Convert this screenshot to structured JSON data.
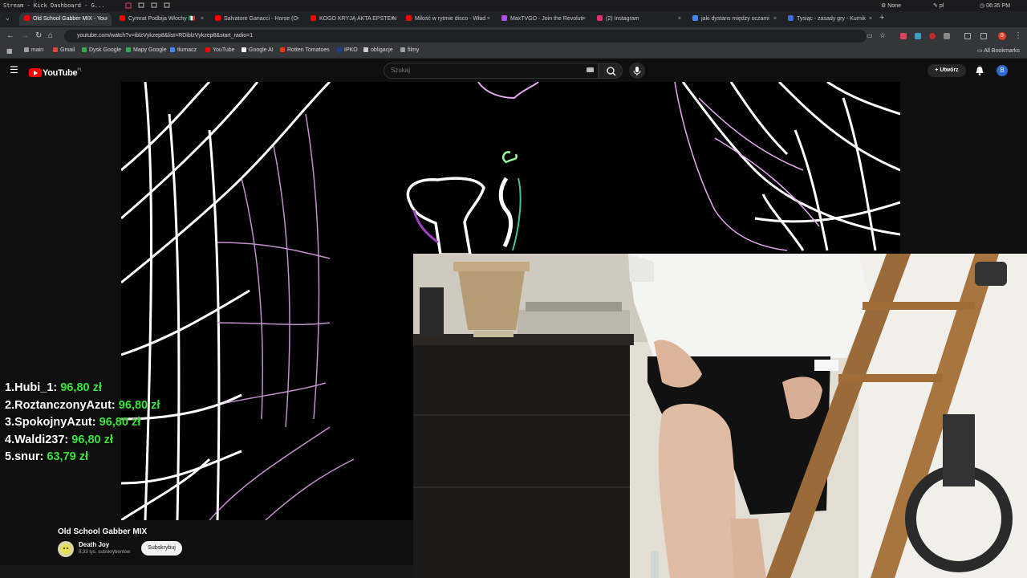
{
  "os_bar": {
    "window_title": "Stream - Kick Dashboard - G...",
    "lang_status": "None",
    "keyboard": "pl",
    "clock": "06:35 PM"
  },
  "tabs": [
    {
      "title": "Old School Gabber MIX - You",
      "color": "#ff0000",
      "active": true
    },
    {
      "title": "Cymrat Podbija Włochy 🇮🇹",
      "color": "#ff0000"
    },
    {
      "title": "Salvatore Ganacci - Horse (O",
      "color": "#ff0000"
    },
    {
      "title": "KOGO KRYJĄ AKTA EPSTEIN",
      "color": "#ff0000"
    },
    {
      "title": "Miłość w rytmie disco - Wład",
      "color": "#ff0000"
    },
    {
      "title": "MaxTVGO - Join the Revoluti",
      "color": "#b24bf3"
    },
    {
      "title": "(2) Instagram",
      "color": "#e1306c"
    },
    {
      "title": "jaki dystans między oczami",
      "color": "#4285f4"
    },
    {
      "title": "Tysiąc - zasady gry - Kurnik",
      "color": "#3b6fd6"
    }
  ],
  "address": {
    "url": "youtube.com/watch?v=iblzVykzep8&list=RDiblzVykzep8&start_radio=1"
  },
  "bookmarks": [
    {
      "label": "main",
      "color": "#9aa0a6"
    },
    {
      "label": "Gmail",
      "color": "#ea4335"
    },
    {
      "label": "Dysk Google",
      "color": "#34a853"
    },
    {
      "label": "Mapy Google",
      "color": "#34a853"
    },
    {
      "label": "tłumacz",
      "color": "#4285f4"
    },
    {
      "label": "YouTube",
      "color": "#ff0000"
    },
    {
      "label": "Google AI",
      "color": "#ffffff"
    },
    {
      "label": "Rotten Tomatoes",
      "color": "#fa320a"
    },
    {
      "label": "IPKO",
      "color": "#1c3f94"
    },
    {
      "label": "obligacje",
      "color": "#cccccc"
    },
    {
      "label": "filmy",
      "color": "#9aa0a6"
    }
  ],
  "all_bookmarks": "All Bookmarks",
  "youtube": {
    "logo_text": "YouTube",
    "logo_region": "PL",
    "search_placeholder": "Szukaj",
    "create_label": "Utwórz",
    "avatar_letter": "B"
  },
  "leaderboard": [
    {
      "rank": "1.",
      "name": "Hubi_1:",
      "amount": "96,80 zł"
    },
    {
      "rank": "2.",
      "name": "RoztanczonyAzut:",
      "amount": "96,80 zł"
    },
    {
      "rank": "3.",
      "name": "SpokojnyAzut:",
      "amount": "96,80 zł"
    },
    {
      "rank": "4.",
      "name": "Waldi237:",
      "amount": "96,80 zł"
    },
    {
      "rank": "5.",
      "name": "snur:",
      "amount": "63,79 zł"
    }
  ],
  "video": {
    "title": "Old School Gabber MIX",
    "channel": "Death Joy",
    "subscribers": "8,33 tys. subskrybentów",
    "subscribe_label": "Subskrybuj"
  }
}
